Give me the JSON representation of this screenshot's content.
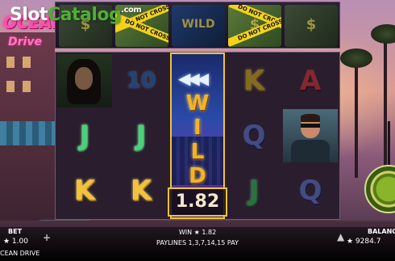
{
  "watermark": {
    "slot": "Slot",
    "catalog": "Catalog",
    "com": ".com"
  },
  "game_logo": {
    "line1": "OCEAN",
    "line2": "Drive"
  },
  "top_row": [
    {
      "type": "cash",
      "band": ""
    },
    {
      "type": "cash",
      "band": "DO NOT CROSS"
    },
    {
      "type": "wild",
      "band": ""
    },
    {
      "type": "cash",
      "band": "DO NOT CROSS"
    },
    {
      "type": "cash",
      "band": ""
    }
  ],
  "reels": {
    "col1": [
      "woman",
      "10",
      "J"
    ],
    "col2": [
      "10",
      "J",
      "K"
    ],
    "col3_wild_letters": [
      "W",
      "I",
      "L",
      "D"
    ],
    "col4": [
      "K",
      "Q",
      "J"
    ],
    "col5": [
      "A",
      "man",
      "Q"
    ],
    "extra": {
      "col1_bottom": "K",
      "col4_bottom": "J"
    }
  },
  "win_amount": "1.82",
  "bottom": {
    "bet_label": "BET",
    "bet_value": "★ 1.00",
    "game_name": "CEAN DRIVE",
    "win_text": "WIN ★ 1.82",
    "paylines_text": "PAYLINES 1,3,7,14,15 PAY",
    "balance_label": "BALANCE",
    "balance_value": "★ 9284.7"
  },
  "colors": {
    "accent_gold": "#f2c23a",
    "brand_green": "#4fae36"
  }
}
